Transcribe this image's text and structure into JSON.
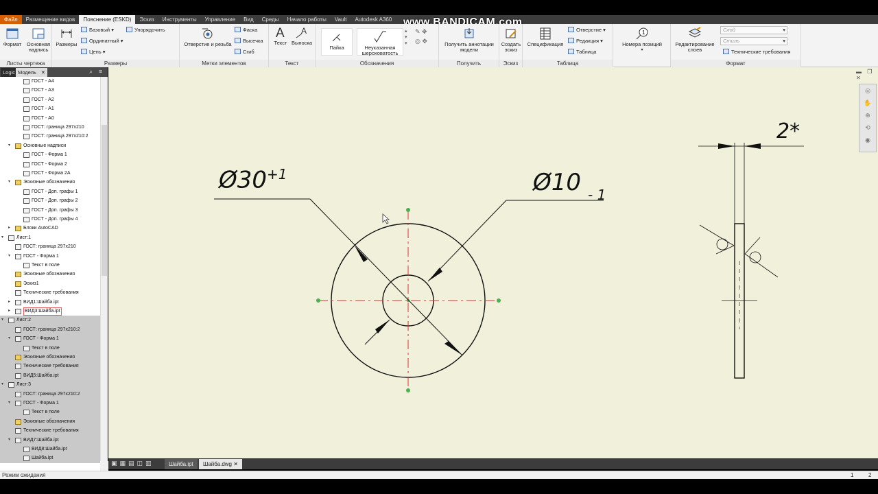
{
  "tabs": [
    "Файл",
    "Размещение видов",
    "Пояснение (ESKD)",
    "Эскиз",
    "Инструменты",
    "Управление",
    "Вид",
    "Среды",
    "Начало работы",
    "Vault",
    "Autodesk A360"
  ],
  "watermark": "www.BANDICAM.com",
  "ribbon": {
    "sheets": {
      "format": "Формат",
      "title_block": "Основная надпись",
      "label": "Листы чертежа"
    },
    "dims": {
      "dimension": "Размеры",
      "baseline": "Базовый",
      "ordinate": "Ординатный",
      "chain": "Цепь",
      "arrange": "Упорядочить",
      "label": "Размеры"
    },
    "features": {
      "hole_thread": "Отверстие и резьба",
      "chamfer": "Фаска",
      "punch": "Высечка",
      "bend": "Сгиб",
      "label": "Метки элементов"
    },
    "text": {
      "text": "Текст",
      "leader": "Выноска",
      "label": "Текст"
    },
    "symbols": {
      "weld": "Пайка",
      "surface": "Неуказанная шероховатость",
      "label": "Обозначения"
    },
    "retrieve": {
      "model_annotations": "Получить аннотации модели",
      "label": "Получить"
    },
    "sketch": {
      "create": "Создать эскиз",
      "label": "Эскиз"
    },
    "table": {
      "spec": "Спецификация",
      "hole": "Отверстие",
      "revision": "Редакция",
      "table": "Таблица",
      "label": "Таблица"
    },
    "balloon": {
      "label_btn": "Номера позиций"
    },
    "format": {
      "edit_layers": "Редактирование слоев",
      "layer": "Слой",
      "style": "Стиль",
      "tech_req": "Технические требования",
      "label": "Формат"
    }
  },
  "browser": {
    "tab_logic": "Logic",
    "tab_model": "Модель",
    "items": [
      {
        "label": "ГОСТ - А4",
        "lvl": 2,
        "icon": "sheet"
      },
      {
        "label": "ГОСТ - А3",
        "lvl": 2,
        "icon": "sheet"
      },
      {
        "label": "ГОСТ - А2",
        "lvl": 2,
        "icon": "sheet"
      },
      {
        "label": "ГОСТ - А1",
        "lvl": 2,
        "icon": "sheet"
      },
      {
        "label": "ГОСТ - А0",
        "lvl": 2,
        "icon": "sheet"
      },
      {
        "label": "ГОСТ: граница 297x210",
        "lvl": 2,
        "icon": "sheet"
      },
      {
        "label": "ГОСТ: граница 297x210:2",
        "lvl": 2,
        "icon": "sheet"
      },
      {
        "label": "Основные надписи",
        "lvl": 1,
        "icon": "folder",
        "exp": "v"
      },
      {
        "label": "ГОСТ - Форма 1",
        "lvl": 2,
        "icon": "sheet"
      },
      {
        "label": "ГОСТ - Форма 2",
        "lvl": 2,
        "icon": "sheet"
      },
      {
        "label": "ГОСТ - Форма 2А",
        "lvl": 2,
        "icon": "sheet"
      },
      {
        "label": "Эскизные обозначения",
        "lvl": 1,
        "icon": "folder",
        "exp": "v"
      },
      {
        "label": "ГОСТ - Доп. графы 1",
        "lvl": 2,
        "icon": "sheet"
      },
      {
        "label": "ГОСТ - Доп. графы 2",
        "lvl": 2,
        "icon": "sheet"
      },
      {
        "label": "ГОСТ - Доп. графы 3",
        "lvl": 2,
        "icon": "sheet"
      },
      {
        "label": "ГОСТ - Доп. графы 4",
        "lvl": 2,
        "icon": "sheet"
      },
      {
        "label": "Блоки AutoCAD",
        "lvl": 1,
        "icon": "folder",
        "exp": ">"
      },
      {
        "label": "Лист:1",
        "lvl": 0,
        "icon": "sheet",
        "exp": "v"
      },
      {
        "label": "ГОСТ: граница 297x210",
        "lvl": 1,
        "icon": "sheet"
      },
      {
        "label": "ГОСТ - Форма 1",
        "lvl": 1,
        "icon": "sheet",
        "exp": "v"
      },
      {
        "label": "Текст в поле",
        "lvl": 2,
        "icon": "text"
      },
      {
        "label": "Эскизные обозначения",
        "lvl": 1,
        "icon": "folder"
      },
      {
        "label": "Эскиз1",
        "lvl": 1,
        "icon": "folder"
      },
      {
        "label": "Технические требования",
        "lvl": 1,
        "icon": "sheet"
      },
      {
        "label": "ВИД1:Шайба.ipt",
        "lvl": 1,
        "icon": "sheet",
        "exp": ">"
      },
      {
        "label": "ВИД3:Шайба.ipt",
        "lvl": 1,
        "icon": "sheet",
        "exp": ">",
        "sel": true
      },
      {
        "label": "Лист:2",
        "lvl": 0,
        "icon": "sheet",
        "exp": "v",
        "grey": true
      },
      {
        "label": "ГОСТ: граница 297x210:2",
        "lvl": 1,
        "icon": "sheet",
        "grey": true
      },
      {
        "label": "ГОСТ - Форма 1",
        "lvl": 1,
        "icon": "sheet",
        "exp": "v",
        "grey": true
      },
      {
        "label": "Текст в поле",
        "lvl": 2,
        "icon": "text",
        "grey": true
      },
      {
        "label": "Эскизные обозначения",
        "lvl": 1,
        "icon": "folder",
        "grey": true
      },
      {
        "label": "Технические требования",
        "lvl": 1,
        "icon": "sheet",
        "grey": true
      },
      {
        "label": "ВИД5:Шайба.ipt",
        "lvl": 1,
        "icon": "sheet",
        "grey": true
      },
      {
        "label": "Лист:3",
        "lvl": 0,
        "icon": "sheet",
        "exp": "v",
        "grey": true
      },
      {
        "label": "ГОСТ: граница 297x210:2",
        "lvl": 1,
        "icon": "sheet",
        "grey": true
      },
      {
        "label": "ГОСТ - Форма 1",
        "lvl": 1,
        "icon": "sheet",
        "exp": "v",
        "grey": true
      },
      {
        "label": "Текст в поле",
        "lvl": 2,
        "icon": "text",
        "grey": true
      },
      {
        "label": "Эскизные обозначения",
        "lvl": 1,
        "icon": "folder",
        "grey": true
      },
      {
        "label": "Технические требования",
        "lvl": 1,
        "icon": "sheet",
        "grey": true
      },
      {
        "label": "ВИД7:Шайба.ipt",
        "lvl": 1,
        "icon": "sheet",
        "exp": "v",
        "grey": true
      },
      {
        "label": "ВИД8:Шайба.ipt",
        "lvl": 2,
        "icon": "sheet",
        "grey": true
      },
      {
        "label": "Шайба.ipt",
        "lvl": 2,
        "icon": "part",
        "grey": true
      }
    ]
  },
  "drawing": {
    "dim_outer": "Ø30",
    "tol_outer": "+1",
    "dim_inner": "Ø10",
    "tol_inner": "- 1",
    "dim_thickness": "2*"
  },
  "doc_tabs": [
    "Шайба.ipt",
    "Шайба.dwg"
  ],
  "status": {
    "text": "Режим ожидания",
    "n1": "1",
    "n2": "2"
  }
}
